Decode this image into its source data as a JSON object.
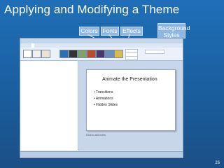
{
  "title": "Applying and Modifying a Theme",
  "callouts": {
    "colors": "Colors",
    "fonts": "Fonts",
    "effects": "Effects",
    "background_line1": "Background",
    "background_line2": "Styles"
  },
  "ppt": {
    "slide_title": "Animate the Presentation",
    "bullets": [
      "Transitions",
      "Animations",
      "Hidden Slides"
    ],
    "notes_placeholder": "Click to add notes"
  },
  "page_number": "26"
}
